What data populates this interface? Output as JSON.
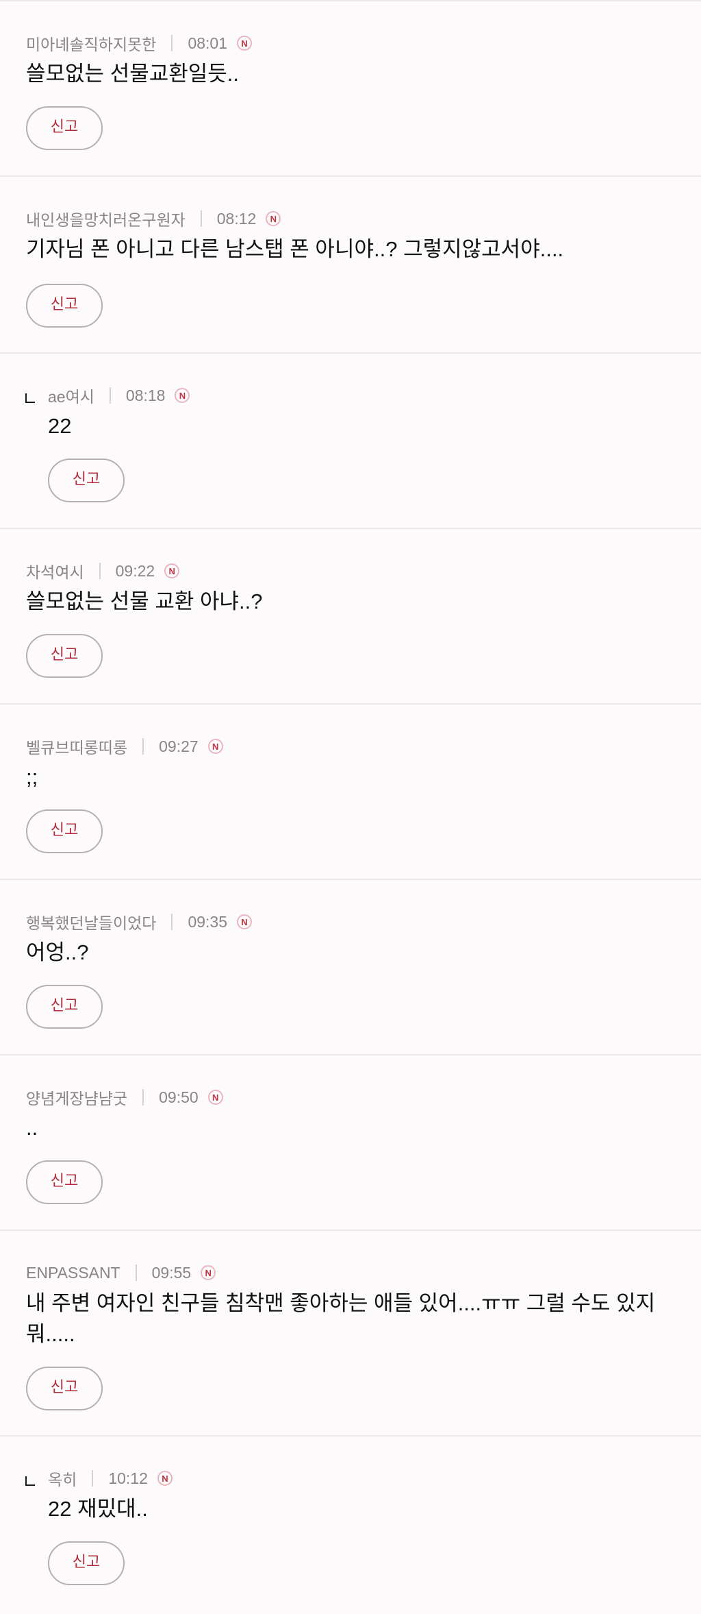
{
  "comments": [
    {
      "nick": "미아녜솔직하지못한",
      "time": "08:01",
      "badge": "N",
      "text": "쓸모없는 선물교환일듯..",
      "report": "신고",
      "reply": false
    },
    {
      "nick": "내인생을망치러온구원자",
      "time": "08:12",
      "badge": "N",
      "text": "기자님 폰 아니고 다른 남스탭 폰 아니야..? 그렇지않고서야....",
      "report": "신고",
      "reply": false
    },
    {
      "nick": "ae여시",
      "time": "08:18",
      "badge": "N",
      "text": "22",
      "report": "신고",
      "reply": true
    },
    {
      "nick": "차석여시",
      "time": "09:22",
      "badge": "N",
      "text": "쓸모없는 선물 교환 아냐..?",
      "report": "신고",
      "reply": false
    },
    {
      "nick": "벨큐브띠롱띠롱",
      "time": "09:27",
      "badge": "N",
      "text": ";;",
      "report": "신고",
      "reply": false
    },
    {
      "nick": "행복했던날들이었다",
      "time": "09:35",
      "badge": "N",
      "text": "어엉..?",
      "report": "신고",
      "reply": false
    },
    {
      "nick": "양념게장냠냠굿",
      "time": "09:50",
      "badge": "N",
      "text": "..",
      "report": "신고",
      "reply": false
    },
    {
      "nick": "ENPASSANT",
      "time": "09:55",
      "badge": "N",
      "text": "내 주변 여자인 친구들 침착맨 좋아하는 애들 있어....ㅠㅠ 그럴 수도 있지 뭐.....",
      "report": "신고",
      "reply": false
    },
    {
      "nick": "옥히",
      "time": "10:12",
      "badge": "N",
      "text": "22 재밌대..",
      "report": "신고",
      "reply": true
    }
  ]
}
